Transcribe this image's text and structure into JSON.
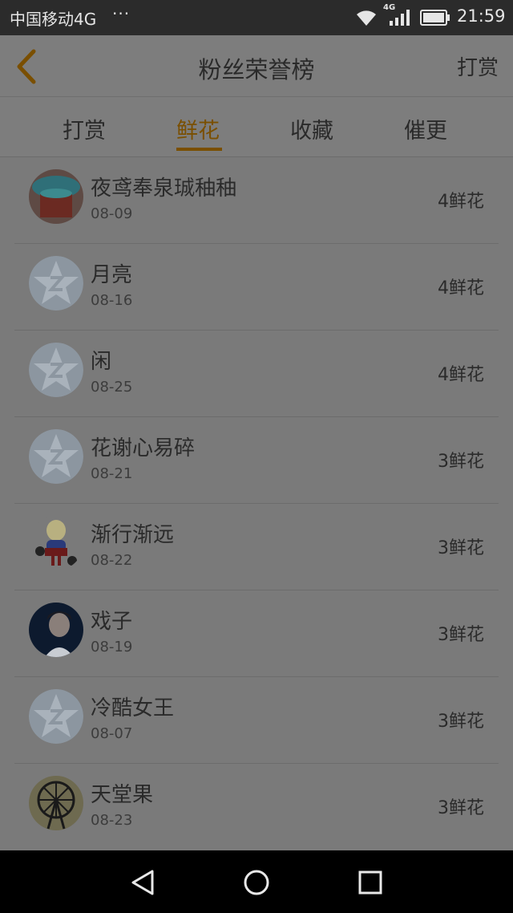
{
  "status_bar": {
    "carrier": "中国移动4G",
    "more": "···",
    "network": "4G",
    "time": "21:59",
    "icons": [
      "wifi-icon",
      "signal-icon",
      "battery-icon"
    ]
  },
  "header": {
    "back_icon": "chevron-left-icon",
    "title": "粉丝荣誉榜",
    "action": "打赏"
  },
  "tabs": [
    {
      "label": "打赏",
      "active": false
    },
    {
      "label": "鲜花",
      "active": true
    },
    {
      "label": "收藏",
      "active": false
    },
    {
      "label": "催更",
      "active": false
    }
  ],
  "colors": {
    "accent": "#7a4f00",
    "overlay_background": "#7a7a7a"
  },
  "list": [
    {
      "name": "夜鸢奉泉珹秞秞",
      "date": "08-09",
      "amount": "4鲜花",
      "avatar": "photo-avatar-blue"
    },
    {
      "name": "月亮",
      "date": "08-16",
      "amount": "4鲜花",
      "avatar": "default-star-avatar"
    },
    {
      "name": "闲",
      "date": "08-25",
      "amount": "4鲜花",
      "avatar": "default-star-avatar"
    },
    {
      "name": "花谢心易碎",
      "date": "08-21",
      "amount": "3鲜花",
      "avatar": "default-star-avatar"
    },
    {
      "name": "渐行渐远",
      "date": "08-22",
      "amount": "3鲜花",
      "avatar": "cartoon-avatar"
    },
    {
      "name": "戏子",
      "date": "08-19",
      "amount": "3鲜花",
      "avatar": "photo-avatar-person"
    },
    {
      "name": "冷酷女王",
      "date": "08-07",
      "amount": "3鲜花",
      "avatar": "default-star-avatar"
    },
    {
      "name": "天堂果",
      "date": "08-23",
      "amount": "3鲜花",
      "avatar": "ferris-wheel-avatar"
    }
  ],
  "nav_bar": [
    "back-triangle-icon",
    "home-circle-icon",
    "recents-square-icon"
  ]
}
